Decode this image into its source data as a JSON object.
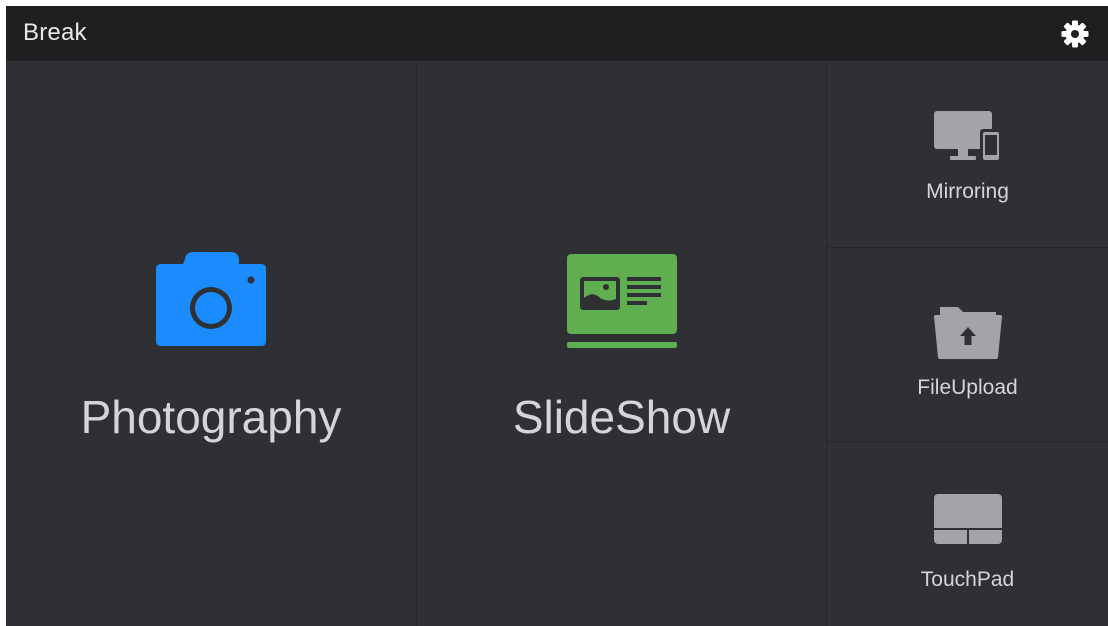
{
  "app": {
    "title": "Break"
  },
  "tiles": {
    "photography": {
      "label": "Photography",
      "icon": "camera-icon",
      "color": "#1a8cff"
    },
    "slideshow": {
      "label": "SlideShow",
      "icon": "slideshow-icon",
      "color": "#5fae4f"
    },
    "mirroring": {
      "label": "Mirroring",
      "icon": "monitor-phone-icon",
      "color": "#a3a4a8"
    },
    "fileupload": {
      "label": "FileUpload",
      "icon": "folder-upload-icon",
      "color": "#a3a4a8"
    },
    "touchpad": {
      "label": "TouchPad",
      "icon": "touchpad-icon",
      "color": "#a3a4a8"
    }
  },
  "header": {
    "settings_icon": "gear-icon"
  }
}
